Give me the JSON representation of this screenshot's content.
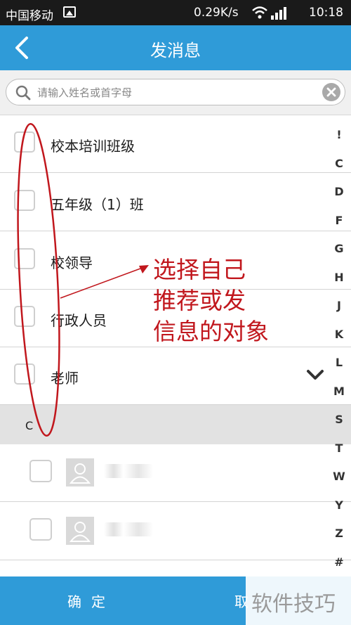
{
  "status_bar": {
    "carrier": "中国移动",
    "speed": "0.29K/s",
    "time": "10:18"
  },
  "header": {
    "title": "发消息"
  },
  "search": {
    "placeholder": "请输入姓名或首字母"
  },
  "groups": [
    {
      "label": "校本培训班级"
    },
    {
      "label": "五年级（1）班"
    },
    {
      "label": "校领导"
    },
    {
      "label": "行政人员"
    },
    {
      "label": "老师"
    }
  ],
  "section": {
    "letter": "C"
  },
  "alphabet_index": [
    "!",
    "C",
    "D",
    "F",
    "G",
    "H",
    "J",
    "K",
    "L",
    "M",
    "S",
    "T",
    "W",
    "Y",
    "Z",
    "#"
  ],
  "bottom": {
    "confirm_label": "确定",
    "cancel_label": "取"
  },
  "annotation": {
    "lines": [
      "选择自己",
      "推荐或发",
      "信息的对象"
    ]
  },
  "watermark": "软件技巧",
  "colors": {
    "header_blue": "#2f9bd8",
    "annotation_red": "#c1171d",
    "section_gray": "#e2e2e2"
  }
}
